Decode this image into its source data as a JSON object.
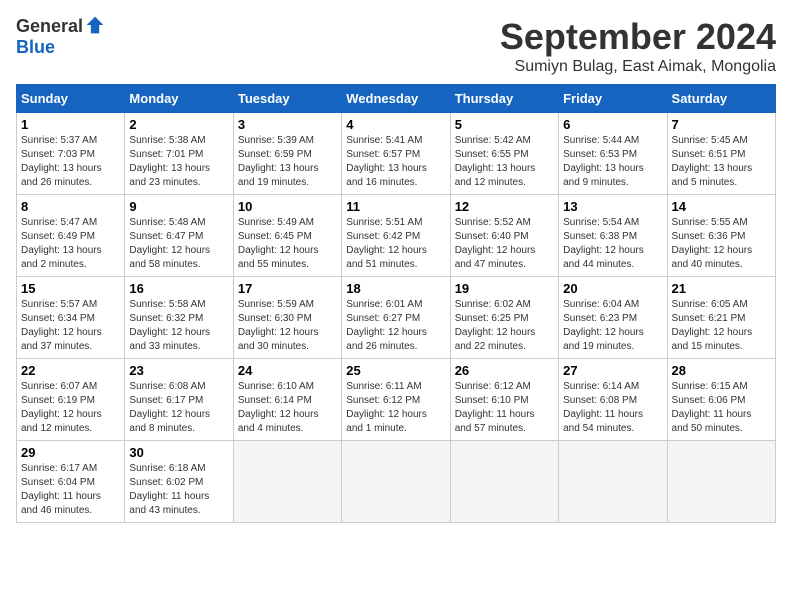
{
  "logo": {
    "general": "General",
    "blue": "Blue"
  },
  "title": "September 2024",
  "subtitle": "Sumiyn Bulag, East Aimak, Mongolia",
  "days_header": [
    "Sunday",
    "Monday",
    "Tuesday",
    "Wednesday",
    "Thursday",
    "Friday",
    "Saturday"
  ],
  "weeks": [
    [
      {
        "day": "1",
        "info": "Sunrise: 5:37 AM\nSunset: 7:03 PM\nDaylight: 13 hours\nand 26 minutes."
      },
      {
        "day": "2",
        "info": "Sunrise: 5:38 AM\nSunset: 7:01 PM\nDaylight: 13 hours\nand 23 minutes."
      },
      {
        "day": "3",
        "info": "Sunrise: 5:39 AM\nSunset: 6:59 PM\nDaylight: 13 hours\nand 19 minutes."
      },
      {
        "day": "4",
        "info": "Sunrise: 5:41 AM\nSunset: 6:57 PM\nDaylight: 13 hours\nand 16 minutes."
      },
      {
        "day": "5",
        "info": "Sunrise: 5:42 AM\nSunset: 6:55 PM\nDaylight: 13 hours\nand 12 minutes."
      },
      {
        "day": "6",
        "info": "Sunrise: 5:44 AM\nSunset: 6:53 PM\nDaylight: 13 hours\nand 9 minutes."
      },
      {
        "day": "7",
        "info": "Sunrise: 5:45 AM\nSunset: 6:51 PM\nDaylight: 13 hours\nand 5 minutes."
      }
    ],
    [
      {
        "day": "8",
        "info": "Sunrise: 5:47 AM\nSunset: 6:49 PM\nDaylight: 13 hours\nand 2 minutes."
      },
      {
        "day": "9",
        "info": "Sunrise: 5:48 AM\nSunset: 6:47 PM\nDaylight: 12 hours\nand 58 minutes."
      },
      {
        "day": "10",
        "info": "Sunrise: 5:49 AM\nSunset: 6:45 PM\nDaylight: 12 hours\nand 55 minutes."
      },
      {
        "day": "11",
        "info": "Sunrise: 5:51 AM\nSunset: 6:42 PM\nDaylight: 12 hours\nand 51 minutes."
      },
      {
        "day": "12",
        "info": "Sunrise: 5:52 AM\nSunset: 6:40 PM\nDaylight: 12 hours\nand 47 minutes."
      },
      {
        "day": "13",
        "info": "Sunrise: 5:54 AM\nSunset: 6:38 PM\nDaylight: 12 hours\nand 44 minutes."
      },
      {
        "day": "14",
        "info": "Sunrise: 5:55 AM\nSunset: 6:36 PM\nDaylight: 12 hours\nand 40 minutes."
      }
    ],
    [
      {
        "day": "15",
        "info": "Sunrise: 5:57 AM\nSunset: 6:34 PM\nDaylight: 12 hours\nand 37 minutes."
      },
      {
        "day": "16",
        "info": "Sunrise: 5:58 AM\nSunset: 6:32 PM\nDaylight: 12 hours\nand 33 minutes."
      },
      {
        "day": "17",
        "info": "Sunrise: 5:59 AM\nSunset: 6:30 PM\nDaylight: 12 hours\nand 30 minutes."
      },
      {
        "day": "18",
        "info": "Sunrise: 6:01 AM\nSunset: 6:27 PM\nDaylight: 12 hours\nand 26 minutes."
      },
      {
        "day": "19",
        "info": "Sunrise: 6:02 AM\nSunset: 6:25 PM\nDaylight: 12 hours\nand 22 minutes."
      },
      {
        "day": "20",
        "info": "Sunrise: 6:04 AM\nSunset: 6:23 PM\nDaylight: 12 hours\nand 19 minutes."
      },
      {
        "day": "21",
        "info": "Sunrise: 6:05 AM\nSunset: 6:21 PM\nDaylight: 12 hours\nand 15 minutes."
      }
    ],
    [
      {
        "day": "22",
        "info": "Sunrise: 6:07 AM\nSunset: 6:19 PM\nDaylight: 12 hours\nand 12 minutes."
      },
      {
        "day": "23",
        "info": "Sunrise: 6:08 AM\nSunset: 6:17 PM\nDaylight: 12 hours\nand 8 minutes."
      },
      {
        "day": "24",
        "info": "Sunrise: 6:10 AM\nSunset: 6:14 PM\nDaylight: 12 hours\nand 4 minutes."
      },
      {
        "day": "25",
        "info": "Sunrise: 6:11 AM\nSunset: 6:12 PM\nDaylight: 12 hours\nand 1 minute."
      },
      {
        "day": "26",
        "info": "Sunrise: 6:12 AM\nSunset: 6:10 PM\nDaylight: 11 hours\nand 57 minutes."
      },
      {
        "day": "27",
        "info": "Sunrise: 6:14 AM\nSunset: 6:08 PM\nDaylight: 11 hours\nand 54 minutes."
      },
      {
        "day": "28",
        "info": "Sunrise: 6:15 AM\nSunset: 6:06 PM\nDaylight: 11 hours\nand 50 minutes."
      }
    ],
    [
      {
        "day": "29",
        "info": "Sunrise: 6:17 AM\nSunset: 6:04 PM\nDaylight: 11 hours\nand 46 minutes."
      },
      {
        "day": "30",
        "info": "Sunrise: 6:18 AM\nSunset: 6:02 PM\nDaylight: 11 hours\nand 43 minutes."
      },
      {
        "day": "",
        "info": ""
      },
      {
        "day": "",
        "info": ""
      },
      {
        "day": "",
        "info": ""
      },
      {
        "day": "",
        "info": ""
      },
      {
        "day": "",
        "info": ""
      }
    ]
  ]
}
